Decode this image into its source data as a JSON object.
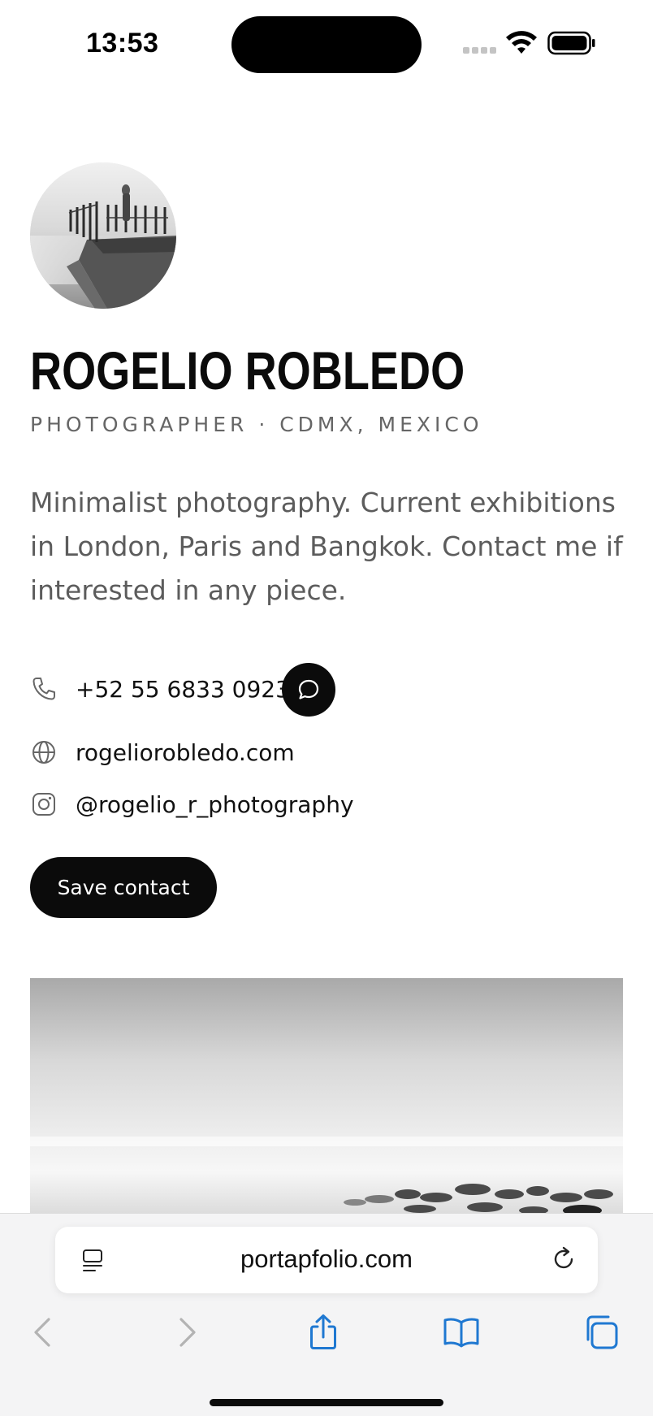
{
  "status_bar": {
    "time": "13:53",
    "icons": [
      "signal-icon",
      "wifi-icon",
      "battery-icon"
    ]
  },
  "profile": {
    "name": "ROGELIO ROBLEDO",
    "subtitle": "PHOTOGRAPHER · CDMX, MEXICO",
    "bio": "Minimalist photography. Current exhibitions in London, Paris and Bangkok. Contact me if interested in any piece."
  },
  "contacts": {
    "phone": "+52 55 6833 0923",
    "website": "rogeliorobledo.com",
    "instagram": "@rogelio_r_photography"
  },
  "actions": {
    "save_contact": "Save contact"
  },
  "browser": {
    "url": "portapfolio.com",
    "toolbar_icons": [
      "back-icon",
      "forward-icon",
      "share-icon",
      "bookmarks-icon",
      "tabs-icon"
    ]
  },
  "colors": {
    "accent_dark": "#0b0b0b",
    "link_blue": "#1f78d1",
    "muted_text": "#5c5c5c"
  }
}
